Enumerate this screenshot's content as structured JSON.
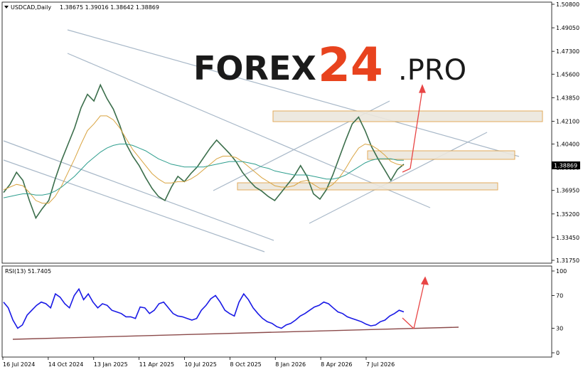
{
  "chart_data": [
    {
      "type": "line",
      "title": "USDCAD,Daily",
      "ohlc_header": "1.38675 1.39016 1.38642 1.38869",
      "current_price_label": "1.38869",
      "price_axis_ticks": [
        "1.50800",
        "1.49050",
        "1.47300",
        "1.45600",
        "1.43850",
        "1.42100",
        "1.40400",
        "1.38650",
        "1.36950",
        "1.35200",
        "1.33450",
        "1.31750"
      ],
      "ylim": [
        1.3175,
        1.508
      ],
      "date_ticks": [
        "16 Jul 2024",
        "14 Oct 2024",
        "13 Jan 2025",
        "11 Apr 2025",
        "10 Jul 2025",
        "8 Oct 2025",
        "8 Jan 2026",
        "8 Apr 2026",
        "7 Jul 2026"
      ],
      "series": [
        {
          "color": "#3b6e4b",
          "values": [
            1.368,
            1.374,
            1.383,
            1.377,
            1.362,
            1.349,
            1.356,
            1.362,
            1.378,
            1.392,
            1.404,
            1.416,
            1.431,
            1.441,
            1.436,
            1.448,
            1.438,
            1.43,
            1.418,
            1.404,
            1.395,
            1.388,
            1.379,
            1.371,
            1.365,
            1.362,
            1.372,
            1.38,
            1.376,
            1.382,
            1.387,
            1.394,
            1.401,
            1.407,
            1.402,
            1.397,
            1.391,
            1.383,
            1.377,
            1.372,
            1.369,
            1.365,
            1.362,
            1.368,
            1.374,
            1.38,
            1.388,
            1.38,
            1.367,
            1.363,
            1.37,
            1.381,
            1.394,
            1.407,
            1.419,
            1.424,
            1.414,
            1.402,
            1.393,
            1.385,
            1.377,
            1.385,
            1.389
          ]
        },
        {
          "color": "#d9a441",
          "values": [
            1.37,
            1.372,
            1.374,
            1.373,
            1.368,
            1.362,
            1.36,
            1.36,
            1.365,
            1.373,
            1.383,
            1.393,
            1.404,
            1.414,
            1.419,
            1.425,
            1.425,
            1.422,
            1.416,
            1.408,
            1.4,
            1.394,
            1.388,
            1.382,
            1.378,
            1.375,
            1.375,
            1.376,
            1.376,
            1.378,
            1.381,
            1.385,
            1.389,
            1.393,
            1.395,
            1.395,
            1.394,
            1.391,
            1.387,
            1.383,
            1.379,
            1.376,
            1.373,
            1.372,
            1.372,
            1.373,
            1.376,
            1.377,
            1.374,
            1.371,
            1.371,
            1.374,
            1.379,
            1.386,
            1.394,
            1.401,
            1.404,
            1.403,
            1.4,
            1.396,
            1.391,
            1.389,
            1.388
          ]
        },
        {
          "color": "#2e9e8e",
          "values": [
            1.364,
            1.365,
            1.366,
            1.367,
            1.367,
            1.366,
            1.366,
            1.367,
            1.369,
            1.372,
            1.376,
            1.38,
            1.385,
            1.39,
            1.394,
            1.398,
            1.401,
            1.403,
            1.404,
            1.404,
            1.403,
            1.401,
            1.399,
            1.396,
            1.393,
            1.391,
            1.389,
            1.388,
            1.387,
            1.387,
            1.387,
            1.387,
            1.388,
            1.389,
            1.39,
            1.391,
            1.391,
            1.391,
            1.39,
            1.389,
            1.387,
            1.386,
            1.384,
            1.383,
            1.382,
            1.381,
            1.381,
            1.381,
            1.38,
            1.379,
            1.378,
            1.378,
            1.379,
            1.381,
            1.384,
            1.387,
            1.39,
            1.392,
            1.393,
            1.393,
            1.393,
            1.392,
            1.392
          ]
        }
      ]
    },
    {
      "type": "line",
      "title": "RSI(13) 51.7405",
      "ylim": [
        0,
        100
      ],
      "ticks": [
        "100",
        "70",
        "30",
        "0"
      ],
      "series": [
        {
          "color": "#1a1ae6",
          "values": [
            62,
            55,
            40,
            30,
            34,
            46,
            52,
            58,
            62,
            60,
            55,
            72,
            68,
            60,
            55,
            70,
            78,
            65,
            72,
            62,
            55,
            60,
            58,
            52,
            50,
            48,
            44,
            44,
            42,
            56,
            55,
            48,
            52,
            60,
            62,
            55,
            48,
            45,
            44,
            42,
            40,
            42,
            52,
            58,
            66,
            70,
            62,
            52,
            48,
            45,
            62,
            72,
            65,
            55,
            48,
            42,
            38,
            36,
            32,
            30,
            34,
            36,
            40,
            45,
            48,
            52,
            56,
            58,
            62,
            60,
            55,
            50,
            48,
            44,
            42,
            40,
            38,
            35,
            33,
            34,
            38,
            40,
            45,
            48,
            52,
            50
          ]
        }
      ],
      "trendline_color": "#8b4a4a"
    }
  ],
  "logo": {
    "part1": "FOREX",
    "part2": "24",
    "part3": ".PRO"
  }
}
